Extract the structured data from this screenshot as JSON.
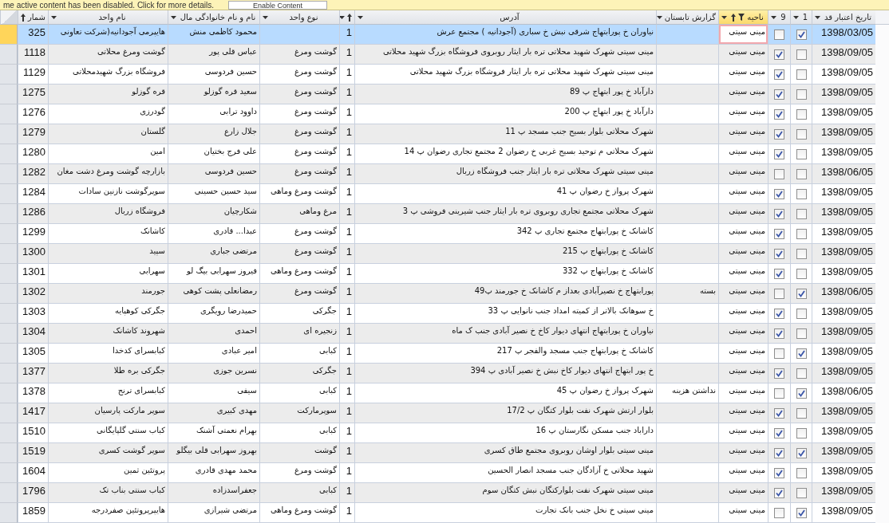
{
  "message_bar": {
    "text": "me active content has been disabled. Click for more details.",
    "button": "Enable Content"
  },
  "table": {
    "columns": [
      {
        "label": "تاریخ اعتبار قد",
        "kind": "date",
        "sorted": false,
        "filtered": false,
        "current": false
      },
      {
        "label": "1",
        "kind": "check",
        "sorted": false,
        "filtered": false
      },
      {
        "label": "9",
        "kind": "check",
        "sorted": false,
        "filtered": false
      },
      {
        "label": "ناحیه",
        "kind": "text",
        "sorted": true,
        "filtered": true,
        "current": true
      },
      {
        "label": "گزارش تابستان",
        "kind": "text",
        "sorted": false,
        "filtered": false,
        "current": false
      },
      {
        "label": "آدرس",
        "kind": "text",
        "sorted": false,
        "filtered": false,
        "current": false
      },
      {
        "kind": "number",
        "sorted": true,
        "filtered": false,
        "current": false
      },
      {
        "label": "نوع  واحد",
        "kind": "text",
        "sorted": false,
        "filtered": false,
        "current": false
      },
      {
        "label": "نام و نام خانوادگی مال",
        "kind": "text",
        "sorted": false,
        "filtered": false,
        "current": false
      },
      {
        "label": "نام واحد",
        "kind": "text",
        "sorted": false,
        "filtered": false,
        "current": false
      },
      {
        "label": "شمار",
        "kind": "number",
        "sorted": true,
        "filtered": false,
        "current": false
      }
    ],
    "rows": [
      {
        "date": "1398/03/05",
        "checked_1": true,
        "checked_9": false,
        "region": "مینی سیتی",
        "address": "نیاوران خ پورابتهاج شرقی نبش خ سباری  (آجودانیه ) مجتمع عرش",
        "column_7": "1",
        "owner": "محمود کاظمی منش",
        "unit": "هایپرمی آجودانیه(شرکت تعاونی",
        "number": "325",
        "selected": true
      },
      {
        "date": "1398/09/05",
        "checked_1": false,
        "checked_9": true,
        "region": "مینی سیتی",
        "address": "مینی سیتی شهرک شهید محلاتی تره بار ایثار روبروی فروشگاه بزرگ شهید محلاتی",
        "column_7": "1",
        "type": "گوشت ومرغ",
        "owner": "عباس قلی پور",
        "unit": "گوشت ومرغ محلاتی",
        "number": "1118",
        "selected": false
      },
      {
        "date": "1398/09/05",
        "checked_1": false,
        "checked_9": true,
        "region": "مینی سیتی",
        "address": "مینی سیتی شهرک شهید محلاتی تره بار ایثار فروشگاه بزرگ شهید محلاتی",
        "column_7": "1",
        "type": "گوشت ومرغ",
        "owner": "حسین فردوسی",
        "unit": "فروشگاه بزرگ شهیدمحلاتی",
        "number": "1129",
        "selected": false
      },
      {
        "date": "1398/09/05",
        "checked_1": false,
        "checked_9": true,
        "region": "مینی سیتی",
        "address": "دارآباد خ پور ابتهاج پ 89",
        "column_7": "1",
        "type": "گوشت ومرغ",
        "owner": "سعید قره گوزلو",
        "unit": "قره گوزلو",
        "number": "1275",
        "selected": false
      },
      {
        "date": "1398/09/05",
        "checked_1": false,
        "checked_9": true,
        "region": "مینی سیتی",
        "address": "دارآباد خ پور ابتهاج پ 200",
        "column_7": "1",
        "type": "گوشت ومرغ",
        "owner": "داوود ترابی",
        "unit": "گودرزی",
        "number": "1276",
        "selected": false
      },
      {
        "date": "1398/09/05",
        "checked_1": false,
        "checked_9": true,
        "region": "مینی سیتی",
        "address": "شهرک محلاتی بلوار بسیج جنب مسجد پ 11",
        "column_7": "1",
        "type": "گوشت ومرغ",
        "owner": "جلال زارع",
        "unit": "گلستان",
        "number": "1279",
        "selected": false
      },
      {
        "date": "1398/09/05",
        "checked_1": false,
        "checked_9": true,
        "region": "مینی سیتی",
        "address": "شهرک محلاتی م توحید بسیج غربی خ رضوان 2 مجتمع تجاری رضوان پ 14",
        "column_7": "1",
        "type": "گوشت ومرغ",
        "owner": "علی فرج بختیان",
        "unit": "امین",
        "number": "1280",
        "selected": false
      },
      {
        "date": "1398/06/05",
        "checked_1": false,
        "checked_9": false,
        "region": "مینی سیتی",
        "address": "مینی سیتی شهرک محلاتی تره بار ایثار جنب فروشگاه زربال",
        "column_7": "1",
        "type": "گوشت ومرغ",
        "owner": "حسین فردوسی",
        "unit": "بازارچه گوشت ومرغ دشت مغان",
        "number": "1282",
        "selected": false
      },
      {
        "date": "1398/09/05",
        "checked_1": false,
        "checked_9": true,
        "region": "مینی سیتی",
        "address": "شهرک پرواز خ رضوان پ 41",
        "column_7": "1",
        "type": "گوشت ومرغ وماهی",
        "owner": "سید حسین حسینی",
        "unit": "سوپرگوشت نازنین سادات",
        "number": "1284",
        "selected": false
      },
      {
        "date": "1398/09/05",
        "checked_1": false,
        "checked_9": true,
        "region": "مینی سیتی",
        "address": "شهرک محلاتی مجتمع تجاری روبروی تره بار ایثار جنب شیرینی فروشی پ 3",
        "column_7": "1",
        "type": "مرغ وماهی",
        "owner": "شکارچیان",
        "unit": "فروشگاه زربال",
        "number": "1286",
        "selected": false
      },
      {
        "date": "1398/09/05",
        "checked_1": false,
        "checked_9": true,
        "region": "مینی سیتی",
        "address": "کاشانک خ پورابتهاج مجتمع تجاری پ 342",
        "column_7": "1",
        "type": "گوشت ومرغ",
        "owner": "عبدا... قادری",
        "unit": "کاشانک",
        "number": "1299",
        "selected": false
      },
      {
        "date": "1398/09/05",
        "checked_1": false,
        "checked_9": true,
        "region": "مینی سیتی",
        "address": "کاشانک خ پورابتهاج پ 215",
        "column_7": "1",
        "type": "گوشت ومرغ",
        "owner": "مرتضی جباری",
        "unit": "سپید",
        "number": "1300",
        "selected": false
      },
      {
        "date": "1398/09/05",
        "checked_1": false,
        "checked_9": true,
        "region": "مینی سیتی",
        "address": "کاشانک خ پورابتهاج پ 332",
        "column_7": "1",
        "type": "گوشت ومرغ وماهی",
        "owner": "فیروز سهرابی بیگ لو",
        "unit": "سهرابی",
        "number": "1301",
        "selected": false
      },
      {
        "date": "1398/06/05",
        "checked_1": true,
        "checked_9": false,
        "region": "مینی سیتی",
        "report": "بسته",
        "address": "پورابتهاج خ نصیرآبادی بعداز م کاشانک خ جورمند پ49",
        "column_7": "1",
        "type": "گوشت ومرغ",
        "owner": "رمضانعلی پشت کوهی",
        "unit": "جورمند",
        "number": "1302",
        "selected": false
      },
      {
        "date": "1398/09/05",
        "checked_1": false,
        "checked_9": true,
        "region": "مینی سیتی",
        "address": "خ سوهانک بالاتر از کمیته امداد جنب نانوایی پ 33",
        "column_7": "1",
        "type": "جگرکی",
        "owner": "حمیدرضا رویگری",
        "unit": "جگرکی کوهپایه",
        "number": "1303",
        "selected": false
      },
      {
        "date": "1398/09/05",
        "checked_1": false,
        "checked_9": true,
        "region": "مینی سیتی",
        "address": "نیاوران خ پورابتهاج انتهای دیوار کاخ  خ نصیر آبادی جنب ک ماه",
        "column_7": "1",
        "type": "زنجیره ای",
        "owner": "احمدی",
        "unit": "شهروند کاشانک",
        "number": "1304",
        "selected": false
      },
      {
        "date": "1398/09/05",
        "checked_1": true,
        "checked_9": false,
        "region": "مینی سیتی",
        "address": "کاشانک خ پورابتهاج جنب مسجد والفجر پ 217",
        "column_7": "1",
        "type": "کبابی",
        "owner": "امیر عبادی",
        "unit": "کبابسرای کدخدا",
        "number": "1305",
        "selected": false
      },
      {
        "date": "1398/09/05",
        "checked_1": false,
        "checked_9": true,
        "region": "مینی سیتی",
        "address": "خ پور ابتهاج انتهای دیوار کاخ نبش خ نصیر آبادی پ 394",
        "column_7": "1",
        "type": "جگرکی",
        "owner": "نسرین جوزی",
        "unit": "جگرکی بره طلا",
        "number": "1377",
        "selected": false
      },
      {
        "date": "1398/06/05",
        "checked_1": true,
        "checked_9": false,
        "region": "مینی سیتی",
        "report": "نداشتن هزینه",
        "address": "شهرک پرواز خ رضوان پ 45",
        "column_7": "1",
        "type": "کبابی",
        "owner": "سیفی",
        "unit": "کبابسرای ترنج",
        "number": "1378",
        "selected": false
      },
      {
        "date": "1398/09/05",
        "checked_1": false,
        "checked_9": true,
        "region": "مینی سیتی",
        "address": "بلوار ارتش شهرک نفت بلوار کتگان پ 17/2",
        "column_7": "1",
        "type": "سوپرمارکت",
        "owner": "مهدی کبیری",
        "unit": "سوپر مارکت پارسیان",
        "number": "1417",
        "selected": false
      },
      {
        "date": "1398/09/05",
        "checked_1": false,
        "checked_9": true,
        "region": "مینی سیتی",
        "address": "داراباد  جنب مسکن نگارستان پ 16",
        "column_7": "1",
        "type": "کبابی",
        "owner": "بهرام نعمتی آشنک",
        "unit": "کباب سنتی گلپایگانی",
        "number": "1510",
        "selected": false
      },
      {
        "date": "1398/09/05",
        "checked_1": true,
        "checked_9": true,
        "region": "مینی سیتی",
        "address": "مینی سیتی بلوار اوشان روبروی مجتمع طاق کسری",
        "column_7": "1",
        "type": "گوشت",
        "owner": "بهروز سهرابی قلی بیگلو",
        "unit": "سوپر گوشت کسری",
        "number": "1519",
        "selected": false
      },
      {
        "date": "1398/09/05",
        "checked_1": false,
        "checked_9": true,
        "region": "مینی سیتی",
        "address": "شهید محلاتی خ آزادگان جنب مسجد انصار الحسین",
        "column_7": "1",
        "type": "گوشت ومرغ",
        "owner": "محمد مهدی قادری",
        "unit": "پروتئین ثمین",
        "number": "1604",
        "selected": false
      },
      {
        "date": "1398/09/05",
        "checked_1": false,
        "checked_9": true,
        "region": "مینی سیتی",
        "address": "مینی سیتی شهرک نفت بلوارکتگان نبش کتگان سوم",
        "column_7": "1",
        "type": "کبابی",
        "owner": "جعفراسدزاده",
        "unit": "کباب سنتی بناب تک",
        "number": "1796",
        "selected": false
      },
      {
        "date": "1398/09/05",
        "checked_1": true,
        "checked_9": false,
        "region": "مینی سیتی",
        "address": "مینی سیتی خ نخل جنب بانک تجارت",
        "column_7": "1",
        "type": "گوشت ومرغ وماهی",
        "owner": "مرتضی شیرازی",
        "unit": "هایپرپروتئین صفردرجه",
        "number": "1859",
        "selected": false
      }
    ]
  }
}
